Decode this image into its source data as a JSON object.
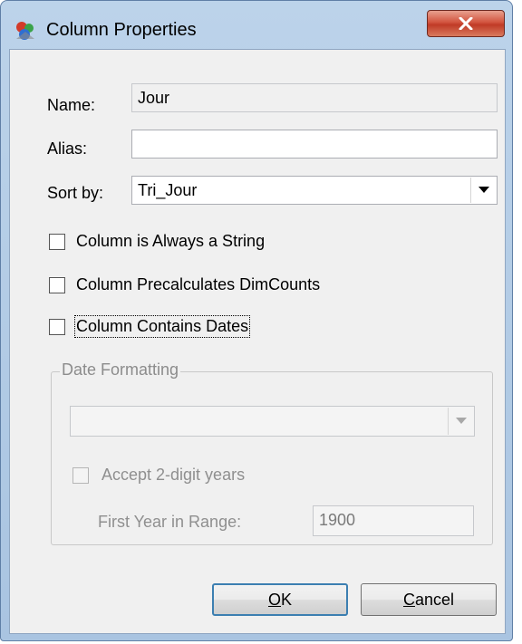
{
  "window": {
    "title": "Column Properties",
    "close_icon": "close-x-icon",
    "app_icon": "app-cube-icon"
  },
  "form": {
    "name_label": "Name:",
    "name_value": "Jour",
    "alias_label": "Alias:",
    "alias_value": "",
    "sortby_label": "Sort by:",
    "sortby_value": "Tri_Jour"
  },
  "options": {
    "always_string_label": "Column is Always a String",
    "always_string_checked": false,
    "precalc_label": "Column Precalculates DimCounts",
    "precalc_checked": false,
    "dates_label": "Column Contains Dates",
    "dates_checked": false
  },
  "date_formatting": {
    "legend": "Date Formatting",
    "format_value": "",
    "accept_2digit_label": "Accept 2-digit years",
    "accept_2digit_checked": false,
    "first_year_label": "First Year in Range:",
    "first_year_value": "1900"
  },
  "buttons": {
    "ok_label": "OK",
    "cancel_label": "Cancel"
  }
}
